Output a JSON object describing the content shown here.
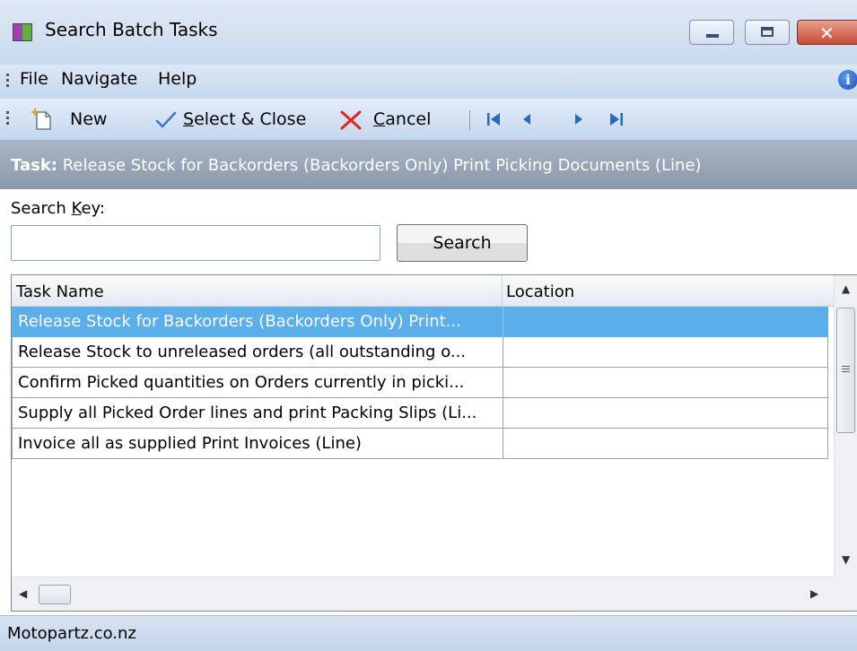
{
  "window": {
    "title": "Search Batch Tasks"
  },
  "menu": {
    "items": [
      "File",
      "Navigate",
      "Help"
    ]
  },
  "toolbar": {
    "new_label": "New",
    "select_close_prefix": "S",
    "select_close_rest": "elect & Close",
    "cancel_prefix": "C",
    "cancel_rest": "ancel"
  },
  "task_banner": {
    "label": "Task:",
    "value": "Release Stock for Backorders (Backorders Only) Print Picking Documents (Line)"
  },
  "search": {
    "label_prefix": "Search ",
    "label_key_letter": "K",
    "label_suffix": "ey:",
    "input_value": "",
    "button_label": "Search"
  },
  "grid": {
    "columns": [
      "Task Name",
      "Location"
    ],
    "rows": [
      {
        "task_name": "Release Stock for Backorders (Backorders Only) Print...",
        "location": ""
      },
      {
        "task_name": "Release Stock to unreleased orders (all outstanding o...",
        "location": ""
      },
      {
        "task_name": "Confirm Picked quantities on Orders currently in picki...",
        "location": ""
      },
      {
        "task_name": "Supply all Picked Order lines and print Packing Slips (Li...",
        "location": ""
      },
      {
        "task_name": "Invoice all as supplied Print Invoices (Line)",
        "location": ""
      }
    ],
    "selected_row": 0
  },
  "statusbar": {
    "text": "Motopartz.co.nz"
  },
  "colors": {
    "selection": "#5aaeea",
    "task_banner": "#94a2b5",
    "close_button": "#c84a33"
  }
}
